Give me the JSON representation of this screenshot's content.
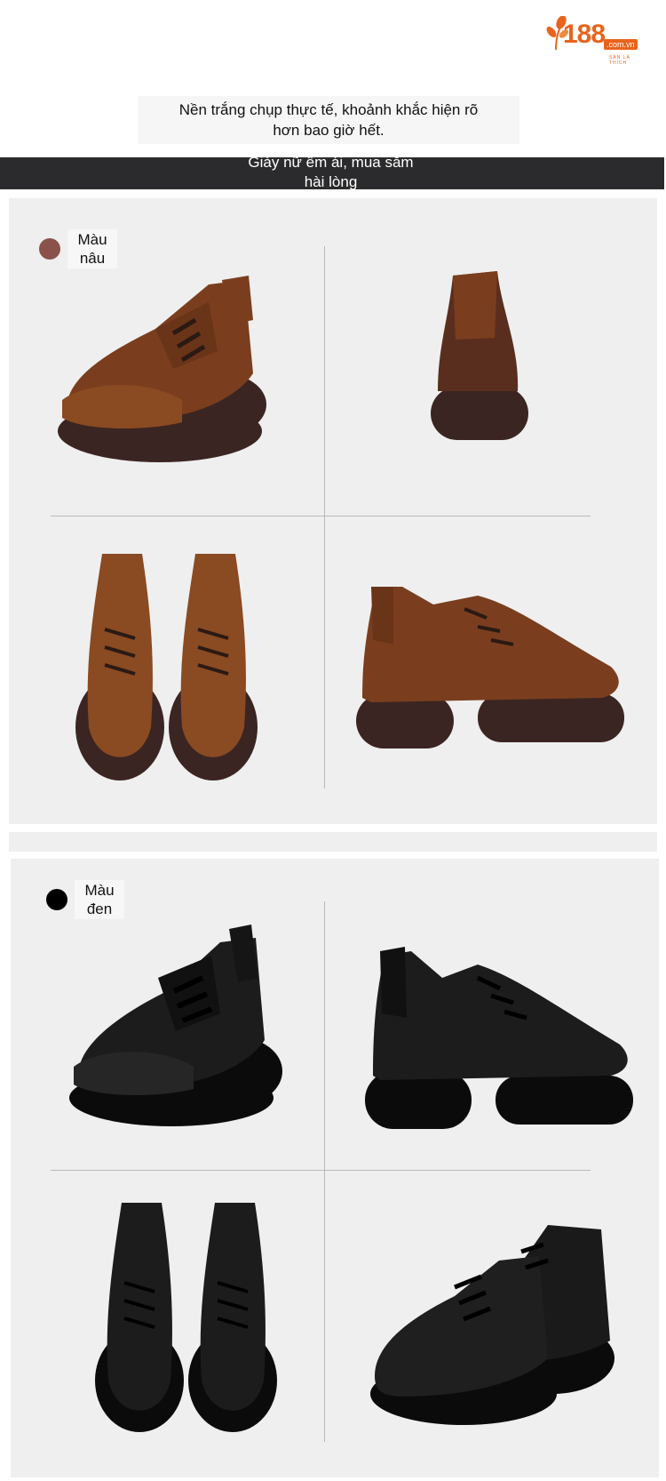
{
  "logo": {
    "number": "188",
    "domain": ".com.vn",
    "tagline": "SĂN LÀ THÍCH"
  },
  "header": {
    "intro_line1": "Nền trắng chụp thực tế, khoảnh khắc hiện rõ",
    "intro_line2": "hơn bao giờ hết.",
    "banner_line1": "Giày nữ êm ái, mua sắm",
    "banner_line2": "hài lòng"
  },
  "variants": [
    {
      "label_line1": "Màu",
      "label_line2": "nâu",
      "swatch_color": "#8a524a"
    },
    {
      "label_line1": "Màu",
      "label_line2": "đen",
      "swatch_color": "#000000"
    }
  ],
  "colors": {
    "banner": "#2b2b2d",
    "panel": "#efefef",
    "brand": "#e8641c"
  }
}
